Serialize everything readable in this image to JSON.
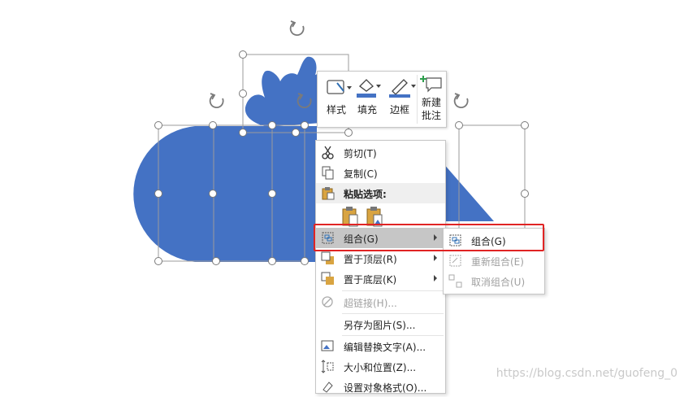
{
  "mini_toolbar": {
    "style_label": "样式",
    "fill_label": "填充",
    "border_label": "边框",
    "comment_line1": "新建",
    "comment_line2": "批注"
  },
  "context_menu": {
    "cut": "剪切(T)",
    "copy": "复制(C)",
    "paste_options": "粘贴选项:",
    "group": "组合(G)",
    "bring_front": "置于顶层(R)",
    "send_back": "置于底层(K)",
    "hyperlink": "超链接(H)...",
    "save_as_picture": "另存为图片(S)...",
    "edit_alt_text": "编辑替换文字(A)...",
    "size_position": "大小和位置(Z)...",
    "format_object": "设置对象格式(O)..."
  },
  "submenu": {
    "group": "组合(G)",
    "regroup": "重新组合(E)",
    "ungroup": "取消组合(U)"
  },
  "watermark": "https://blog.csdn.net/guofeng_0",
  "colors": {
    "shape_fill": "#4472c4",
    "highlight": "#c6c6c6",
    "red_outline": "#e02424"
  }
}
